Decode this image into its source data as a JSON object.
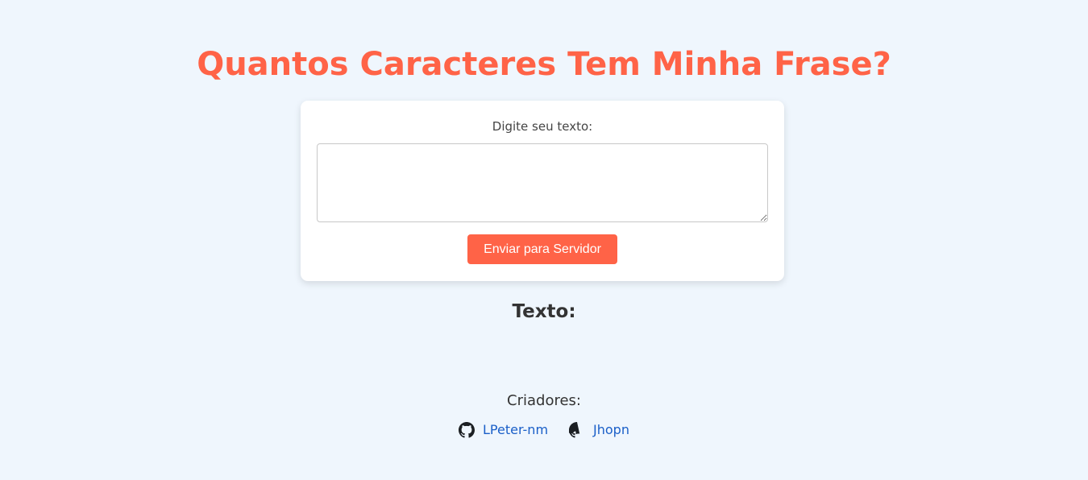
{
  "title": "Quantos Caracteres Tem Minha Frase?",
  "form": {
    "label": "Digite seu texto:",
    "input_value": "",
    "submit_label": "Enviar para Servidor"
  },
  "result": {
    "heading": "Texto:"
  },
  "footer": {
    "creators_label": "Criadores:",
    "creators": [
      {
        "name": "LPeter-nm",
        "icon": "github-icon"
      },
      {
        "name": "Jhopn",
        "icon": "github-icon"
      }
    ]
  },
  "colors": {
    "background": "#eff6fd",
    "accent": "#ff6347",
    "link": "#1a5fc8",
    "card": "#ffffff"
  }
}
